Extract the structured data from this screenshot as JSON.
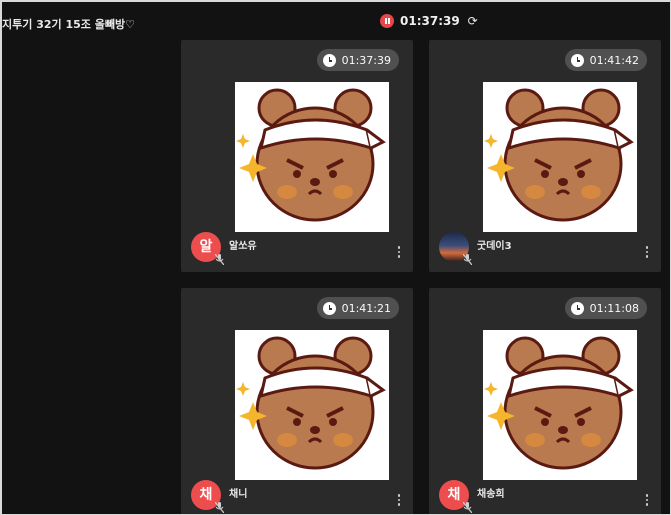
{
  "room": {
    "title": "지투기 32기 15조 올빼방♡"
  },
  "timer": {
    "elapsed": "01:37:39"
  },
  "participants": [
    {
      "name": "알쏘유",
      "avatar_letter": "알",
      "time": "01:37:39",
      "avatar_color": "#ee4d4d"
    },
    {
      "name": "굿데이3",
      "avatar_letter": "",
      "time": "01:41:42",
      "avatar_color": "#3b4d7a"
    },
    {
      "name": "채니",
      "avatar_letter": "채",
      "time": "01:41:21",
      "avatar_color": "#ee4d4d"
    },
    {
      "name": "채송희",
      "avatar_letter": "채",
      "time": "01:11:08",
      "avatar_color": "#ee4d4d"
    }
  ],
  "icons": {
    "pause": "pause-icon",
    "refresh": "refresh-icon",
    "clock": "clock-icon",
    "mic_off": "mic-off-icon",
    "more": "more-vertical-icon"
  }
}
